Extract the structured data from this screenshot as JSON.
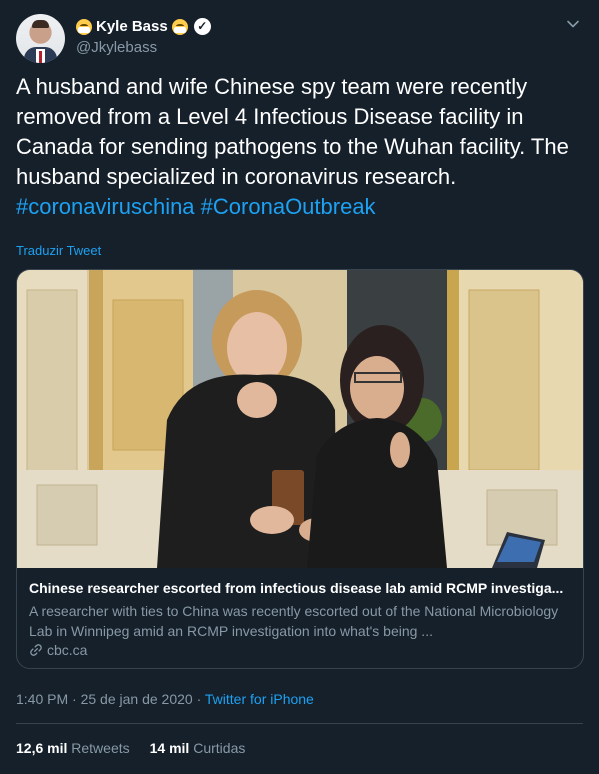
{
  "author": {
    "display_name": "Kyle Bass",
    "handle": "@Jkylebass",
    "verified": true,
    "name_emojis": [
      "face-with-medical-mask",
      "face-with-medical-mask"
    ]
  },
  "tweet": {
    "text_parts": [
      "A husband and wife Chinese spy team were recently removed from a Level 4 Infectious Disease facility in Canada for sending pathogens to the Wuhan facility. The husband specialized in coronavirus research. ",
      "#coronaviruschina",
      " ",
      "#CoronaOutbreak"
    ],
    "translate_label": "Traduzir Tweet"
  },
  "card": {
    "title": "Chinese researcher escorted from infectious disease lab amid RCMP investiga...",
    "description": "A researcher with ties to China was recently escorted out of the National Microbiology Lab in Winnipeg amid an RCMP investigation into what's being ...",
    "domain": "cbc.ca"
  },
  "meta": {
    "time": "1:40 PM",
    "separator": " · ",
    "date": "25 de jan de 2020",
    "separator2": " · ",
    "source": "Twitter for iPhone"
  },
  "stats": {
    "retweets_count": "12,6 mil",
    "retweets_label": "Retweets",
    "likes_count": "14 mil",
    "likes_label": "Curtidas"
  },
  "colors": {
    "background": "#15202b",
    "accent": "#1da1f2",
    "secondary_text": "#8899a6",
    "border": "#38444d"
  }
}
